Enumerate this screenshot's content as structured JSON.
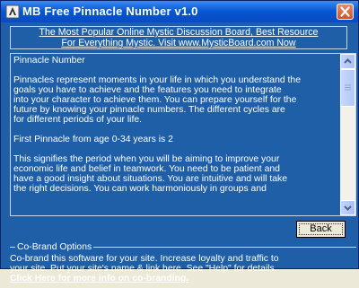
{
  "window": {
    "title": "MB Free Pinnacle Number v1.0",
    "icons": {
      "app": "pinnacle-app-icon",
      "close": "close-icon"
    }
  },
  "banner": {
    "line1": "The Most Popular Online Mystic Discussion Board, Best Resource",
    "line2": "For Everything Mystic. Visit www.MysticBoard.com Now"
  },
  "content": {
    "heading": "Pinnacle Number",
    "paragraph1": "Pinnacles represent moments in your life in which you understand the\ngoals you have to achieve and the features you need to integrate\ninto your character to achieve them. You can prepare yourself for the\nfuture by knowing your pinnacle numbers. The different cycles are\nfor different periods of your life.",
    "first_pinnacle": "First Pinnacle from age 0-34 years is 2",
    "paragraph2": "This signifies the period when you will be aiming to improve your\neconomic life and belief in teamwork. You need to be patient and\nhave a good insight about situations. You are intuitive and will take\nthe right decisions. You can work harmoniously in groups and"
  },
  "buttons": {
    "back": "Back"
  },
  "cobrand": {
    "title": "Co-Brand Options",
    "text": "Co-brand this software for your site.  Increase loyalty and traffic to\nyour site. Put your site's name &  link here. See \"Help\" for details.",
    "link": "Click Here for more info on co-branding."
  },
  "colors": {
    "background": "#1f5fa8",
    "titlebar": "#0a5ad6",
    "close": "#d2502a",
    "text": "#ffffff"
  }
}
